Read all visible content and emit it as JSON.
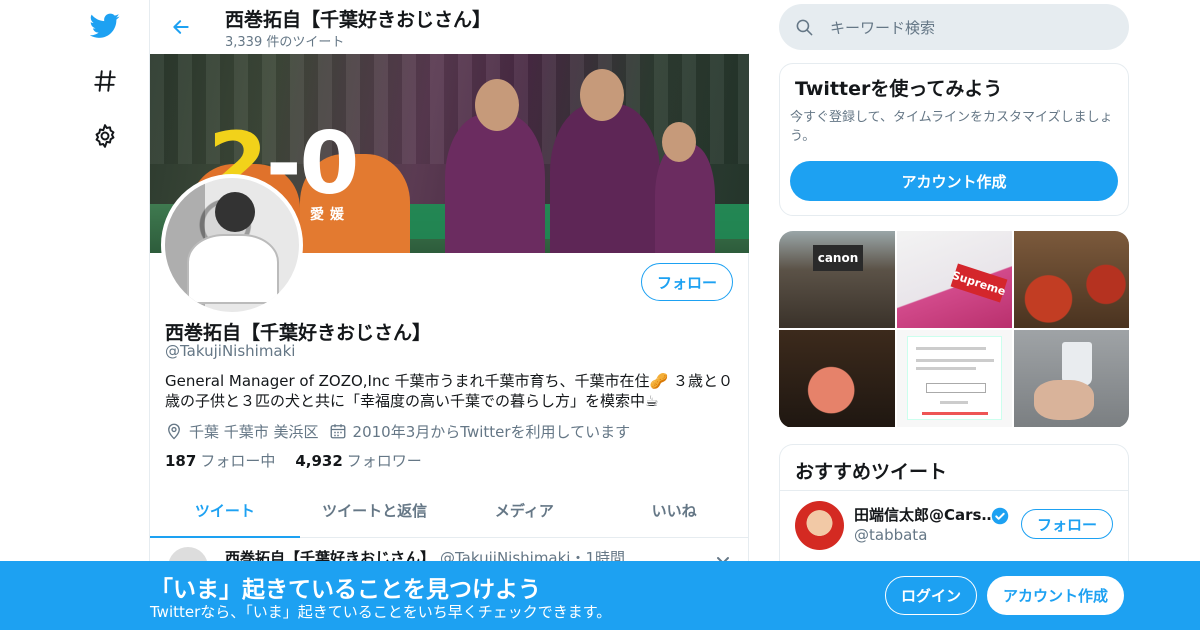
{
  "header": {
    "title": "西巻拓自【千葉好きおじさん】",
    "tweet_count": "3,339 件のツイート"
  },
  "banner": {
    "score": "2-0",
    "score_home": "2",
    "score_rest": "-0",
    "city": "愛媛"
  },
  "profile": {
    "name": "西巻拓自【千葉好きおじさん】",
    "handle": "@TakujiNishimaki",
    "bio": "General Manager of ZOZO,Inc 千葉市うまれ千葉市育ち、千葉市在住🥜 ３歳と０歳の子供と３匹の犬と共に「幸福度の高い千葉での暮らし方」を模索中☕",
    "location": "千葉 千葉市 美浜区",
    "joined": "2010年3月からTwitterを利用しています",
    "following_count": "187",
    "following_label": "フォロー中",
    "followers_count": "4,932",
    "followers_label": "フォロワー",
    "follow_button": "フォロー"
  },
  "tabs": [
    {
      "label": "ツイート"
    },
    {
      "label": "ツイートと返信"
    },
    {
      "label": "メディア"
    },
    {
      "label": "いいね"
    }
  ],
  "tweet_peek": {
    "name": "西巻拓自【千葉好きおじさん】",
    "meta": "@TakujiNishimaki・1時間"
  },
  "search": {
    "placeholder": "キーワード検索"
  },
  "signup_card": {
    "title": "Twitterを使ってみよう",
    "description": "今すぐ登録して、タイムラインをカスタマイズしましょう。",
    "button": "アカウント作成"
  },
  "media": {
    "tile1_sign": "canon",
    "tile2_box": "Supreme"
  },
  "recommended": {
    "title": "おすすめツイート",
    "user_name": "田端信太郎@Cars…",
    "user_handle": "@tabbata",
    "follow_button": "フォロー"
  },
  "bottom_bar": {
    "title": "「いま」起きていることを見つけよう",
    "subtitle": "Twitterなら、「いま」起きていることをいち早くチェックできます。",
    "login_button": "ログイン",
    "signup_button": "アカウント作成"
  },
  "colors": {
    "accent": "#1da1f2",
    "text": "#14171a",
    "muted": "#657786",
    "border": "#e6ecf0"
  }
}
